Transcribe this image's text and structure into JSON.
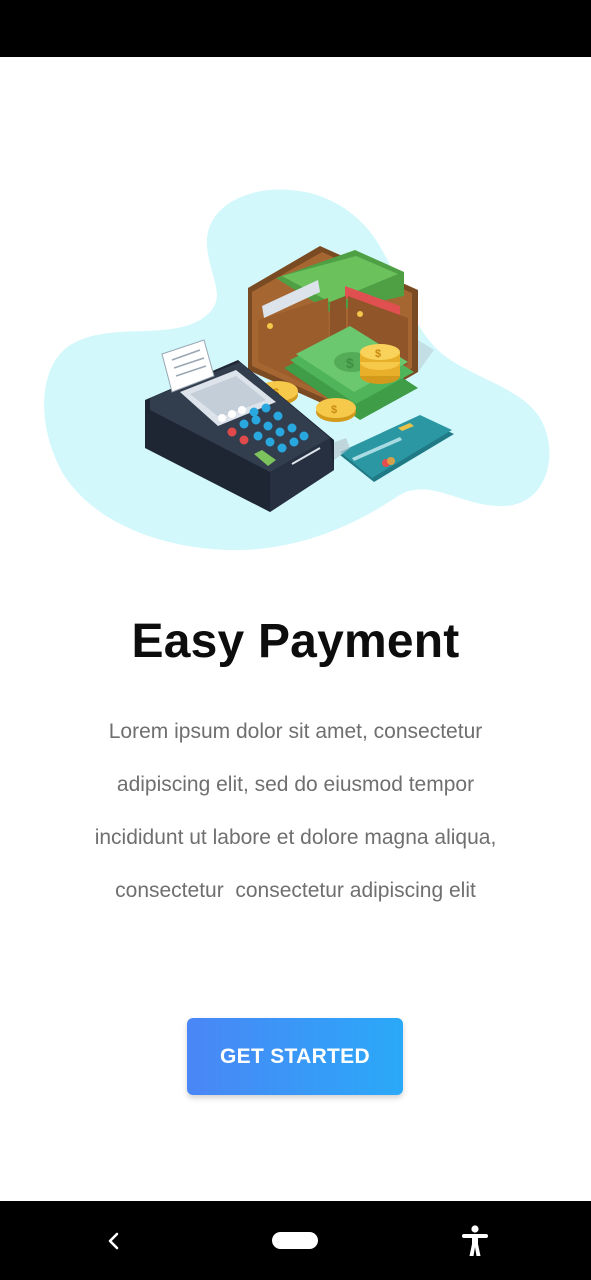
{
  "onboarding": {
    "title": "Easy Payment",
    "description_lines": [
      "Lorem ipsum dolor sit amet, consectetur",
      "adipiscing elit, sed do eiusmod tempor",
      "incididunt ut labore et dolore magna aliqua,",
      "consectetur  consectetur adipiscing elit"
    ],
    "cta_label": "GET STARTED",
    "illustration_icon": "payment-illustration"
  },
  "nav": {
    "back_icon": "chevron-left-icon",
    "home_icon": "home-pill-icon",
    "accessibility_icon": "accessibility-icon"
  },
  "colors": {
    "cta_gradient_start": "#4a86f6",
    "cta_gradient_end": "#2aa9f8",
    "blob": "#d2f8fc",
    "title": "#0d0d0d",
    "body_text": "#6f6f6f"
  }
}
